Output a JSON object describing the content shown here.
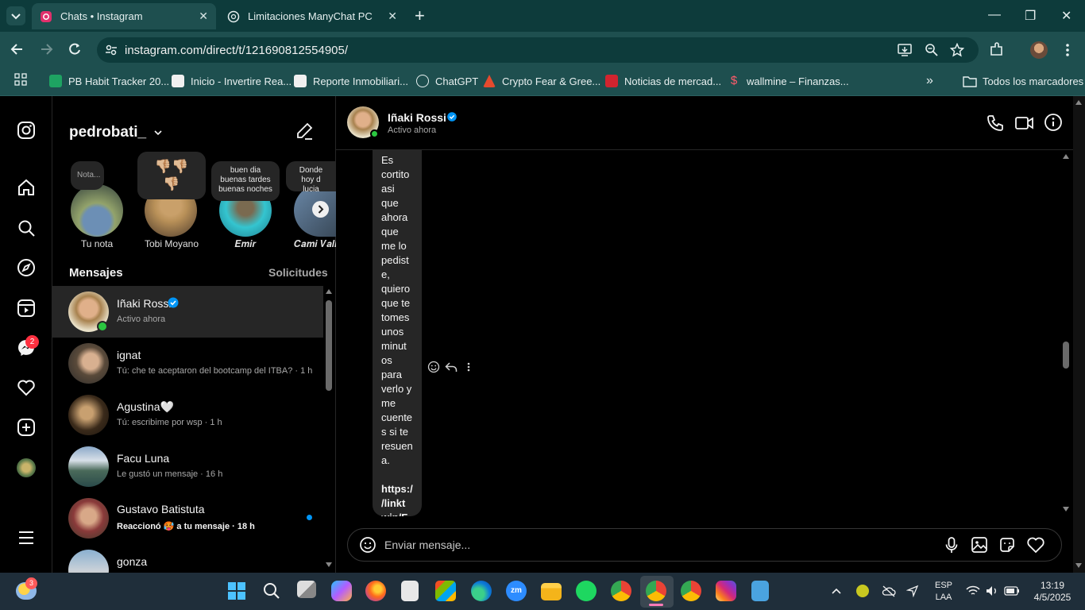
{
  "browser": {
    "tabs": [
      {
        "title": "Chats • Instagram",
        "active": true
      },
      {
        "title": "Limitaciones ManyChat PC",
        "active": false
      }
    ],
    "new_tab": "+",
    "url": "instagram.com/direct/t/121690812554905/",
    "bookmarks": [
      "PB Habit Tracker 20...",
      "Inicio - Invertire Rea...",
      "Reporte Inmobiliari...",
      "ChatGPT",
      "Crypto Fear & Gree...",
      "Noticias de mercad...",
      "wallmine – Finanzas..."
    ],
    "overflow": "»",
    "all_bookmarks": "Todos los marcadores"
  },
  "rail": {
    "messenger_badge": "2"
  },
  "list": {
    "username": "pedrobati_",
    "stories": [
      {
        "label": "Tu nota",
        "note": "Nota..."
      },
      {
        "label": "Tobi Moyano",
        "note": "👎🏼👎🏼\n👎🏼"
      },
      {
        "label": "𝑬𝒎𝒊𝒓",
        "note": "buen dia\nbuenas tardes\nbuenas noches"
      },
      {
        "label": "𝑪𝒂𝒎𝒊 𝑽𝒂𝒍𝒍",
        "note": "Donde hoy d\nlucia"
      }
    ],
    "messages_title": "Mensajes",
    "requests": "Solicitudes",
    "chats": [
      {
        "name": "Iñaki Rossi",
        "sub": "Activo ahora"
      },
      {
        "name": "ignat",
        "sub": "Tú: che te aceptaron del bootcamp del ITBA? · 1 h"
      },
      {
        "name": "Agustina🤍",
        "sub": "Tú: escribime por wsp · 1 h"
      },
      {
        "name": "Facu Luna",
        "sub": "Le gustó un mensaje · 16 h"
      },
      {
        "name": "Gustavo Batistuta",
        "sub": "Reaccionó 🥵 a tu mensaje · 18 h"
      },
      {
        "name": "gonza",
        "sub": ""
      }
    ]
  },
  "chat": {
    "name": "Iñaki Rossi",
    "status": "Activo ahora",
    "message": "Es\ncortito\nasi\nque\nahora\nque\nme lo\npedist\ne,\nquiero\nque te\ntomes\nunos\nminut\nos\npara\nverlo y\nme\ncuente\ns si te\nresuen\na.\n\n",
    "link": "https:/\n/linkt\nwin/F",
    "composer_placeholder": "Enviar mensaje..."
  },
  "taskbar": {
    "weather_badge": "3",
    "lang1": "ESP",
    "lang2": "LAA",
    "time": "13:19",
    "date": "4/5/2025"
  },
  "colors": {
    "chrome_dark": "#0d3b3b",
    "chrome": "#1e4f4f",
    "verified": "#0095f6",
    "online": "#2bc740",
    "bubble": "#262626",
    "badge": "#ff3040"
  }
}
